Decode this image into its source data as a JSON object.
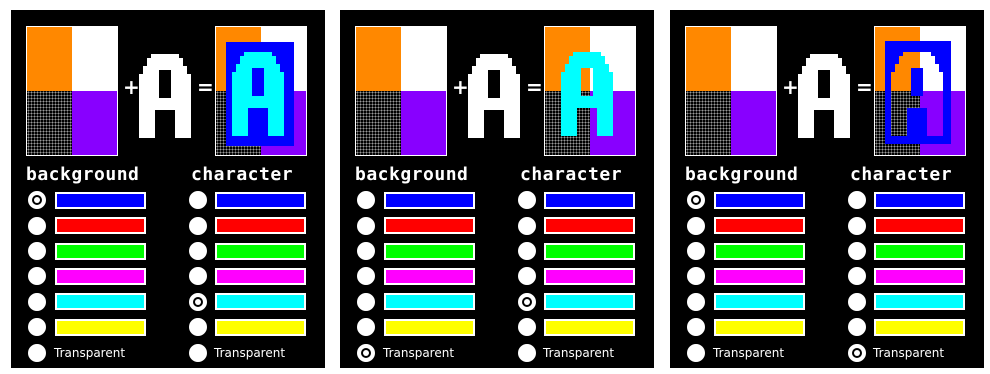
{
  "colors": {
    "orange": "#ff8800",
    "white": "#ffffff",
    "purple": "#8800ff",
    "blue": "#0000ff",
    "red": "#ff0000",
    "green": "#00ff00",
    "magenta": "#ff00ff",
    "cyan": "#00ffff",
    "yellow": "#ffff00"
  },
  "labels": {
    "background": "background",
    "character": "character",
    "plus": "+",
    "equals": "=",
    "transparent": "Transparent"
  },
  "swatch_colors": [
    "#0000ff",
    "#ff0000",
    "#00ff00",
    "#ff00ff",
    "#00ffff",
    "#ffff00"
  ],
  "panels": [
    {
      "background_selected": "blue",
      "character_selected": "cyan"
    },
    {
      "background_selected": "transparent",
      "character_selected": "cyan"
    },
    {
      "background_selected": "blue",
      "character_selected": "transparent"
    }
  ]
}
